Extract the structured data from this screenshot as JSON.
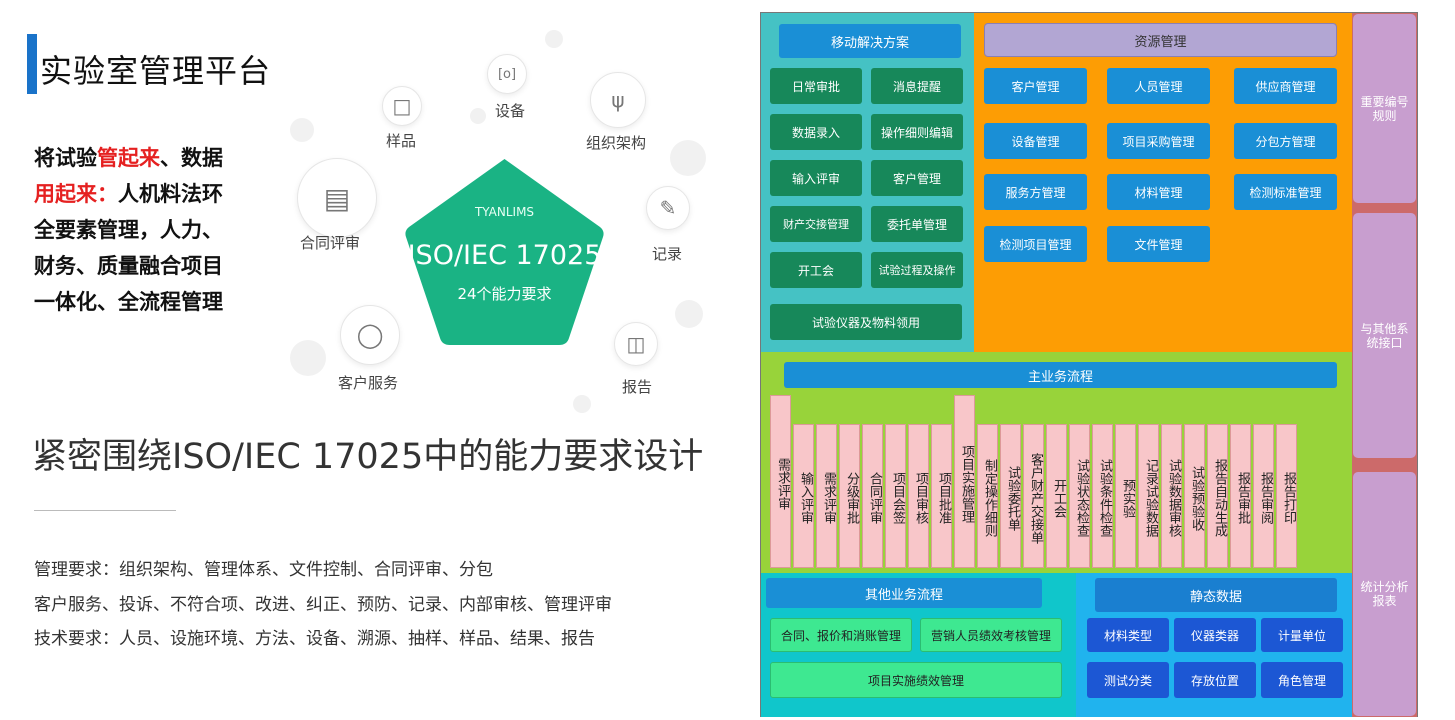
{
  "left": {
    "title": "实验室管理平台",
    "slogan": {
      "l1a": "将试验",
      "l1b": "管起来",
      "l1c": "、数据",
      "l2a": "用起来：",
      "l2b": "人机料法环",
      "l3": "全要素管理，人力、",
      "l4": "财务、质量融合项目",
      "l5": "一体化、全流程管理"
    },
    "nodes": {
      "sample": "样品",
      "device": "设备",
      "org": "组织架构",
      "contract": "合同评审",
      "record": "记录",
      "customer": "客户服务",
      "report": "报告"
    },
    "pentagon": {
      "logo": "TYANLIMS",
      "title": "ISO/IEC 17025",
      "subtitle": "24个能力要求"
    },
    "headline": "紧密围绕ISO/IEC 17025中的能力要求设计",
    "requirements": [
      "管理要求：组织架构、管理体系、文件控制、合同评审、分包",
      "客户服务、投诉、不符合项、改进、纠正、预防、记录、内部审核、管理评审",
      "技术要求：人员、设施环境、方法、设备、溯源、抽样、样品、结果、报告"
    ]
  },
  "diagram": {
    "mobile": {
      "header": "移动解决方案",
      "items": [
        "日常审批",
        "消息提醒",
        "数据录入",
        "操作细则编辑",
        "输入评审",
        "客户管理",
        "财产交接管理",
        "委托单管理",
        "开工会",
        "试验过程及操作",
        "试验仪器及物料领用"
      ]
    },
    "resource": {
      "header": "资源管理",
      "items": [
        "客户管理",
        "人员管理",
        "供应商管理",
        "设备管理",
        "项目采购管理",
        "分包方管理",
        "服务方管理",
        "材料管理",
        "检测标准管理",
        "检测项目管理",
        "文件管理"
      ]
    },
    "side": [
      "重要编号规则",
      "与其他系统接口",
      "统计分析报表"
    ],
    "main_flow": {
      "header": "主业务流程",
      "steps": [
        "需求评审",
        "输入评审",
        "需求评审",
        "分级审批",
        "合同评审",
        "项目会签",
        "项目审核",
        "项目批准",
        "项目实施管理",
        "制定操作细则",
        "试验委托单",
        "客户财产交接单",
        "开工会",
        "试验状态检查",
        "试验条件检查",
        "预实验",
        "记录试验数据",
        "试验数据审核",
        "试验预验收",
        "报告自动生成",
        "报告审批",
        "报告审阅",
        "报告打印"
      ]
    },
    "other_flow": {
      "header": "其他业务流程",
      "items": [
        "合同、报价和消账管理",
        "营销人员绩效考核管理",
        "项目实施绩效管理"
      ]
    },
    "static_data": {
      "header": "静态数据",
      "items": [
        "材料类型",
        "仪器类器",
        "计量单位",
        "测试分类",
        "存放位置",
        "角色管理"
      ]
    }
  },
  "colors": {
    "mobile_bg": "#45c2c4",
    "resource_bg": "#fd9d04",
    "main_bg": "#98d33a",
    "other_bg": "#10c6cb",
    "static_bg": "#20b3ee",
    "side_bg": "#c89ecf",
    "pentagon": "#1ab384"
  }
}
